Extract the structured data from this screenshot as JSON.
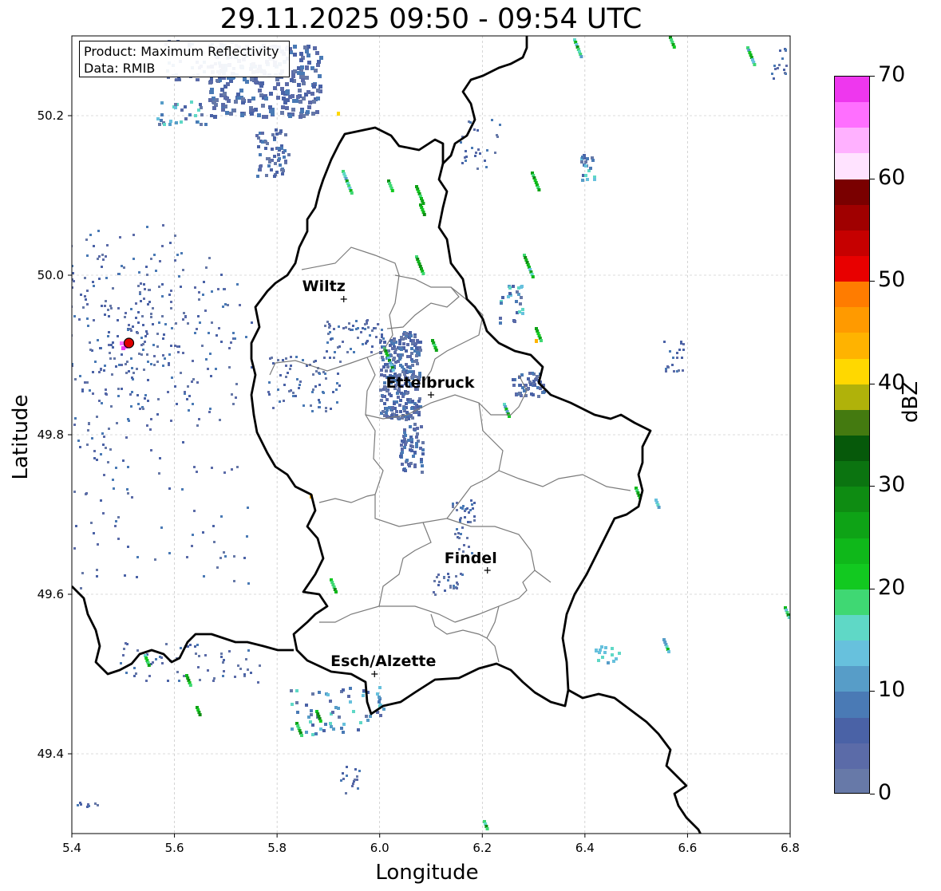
{
  "title": "29.11.2025 09:50 - 09:54 UTC",
  "info": {
    "product": "Product: Maximum Reflectivity",
    "data": "Data: RMIB"
  },
  "axes": {
    "xlabel": "Longitude",
    "ylabel": "Latitude",
    "xticks": [
      "5.4",
      "5.6",
      "5.8",
      "6.0",
      "6.2",
      "6.4",
      "6.6",
      "6.8"
    ],
    "yticks": [
      "49.4",
      "49.6",
      "49.8",
      "50.0",
      "50.2"
    ],
    "xlim": [
      5.4,
      6.8
    ],
    "ylim": [
      49.3,
      50.3
    ]
  },
  "colorbar": {
    "label": "dBZ",
    "ticks": [
      "0",
      "10",
      "20",
      "30",
      "40",
      "50",
      "60",
      "70"
    ],
    "range": [
      0,
      70
    ],
    "colors": [
      "#6779a8",
      "#5b6ba8",
      "#4a62a6",
      "#4a7ab5",
      "#579dc8",
      "#67c1dd",
      "#5fd8c6",
      "#3fd873",
      "#12c920",
      "#0fb81a",
      "#0ea316",
      "#0e8c12",
      "#0b7410",
      "#06590a",
      "#447a10",
      "#b0b20a",
      "#ffd800",
      "#ffb300",
      "#ff9a00",
      "#ff7c00",
      "#e80000",
      "#c60000",
      "#a00000",
      "#7a0000",
      "#ffe3ff",
      "#ffb1ff",
      "#ff6fff",
      "#ee37ee"
    ]
  },
  "cities": [
    {
      "name": "Wiltz",
      "lon": 5.93,
      "lat": 49.97
    },
    {
      "name": "Ettelbruck",
      "lon": 6.1,
      "lat": 49.85
    },
    {
      "name": "Findel",
      "lon": 6.21,
      "lat": 49.63
    },
    {
      "name": "Esch/Alzette",
      "lon": 5.99,
      "lat": 49.5
    }
  ],
  "radar_site": {
    "lon": 5.505,
    "lat": 49.915
  }
}
